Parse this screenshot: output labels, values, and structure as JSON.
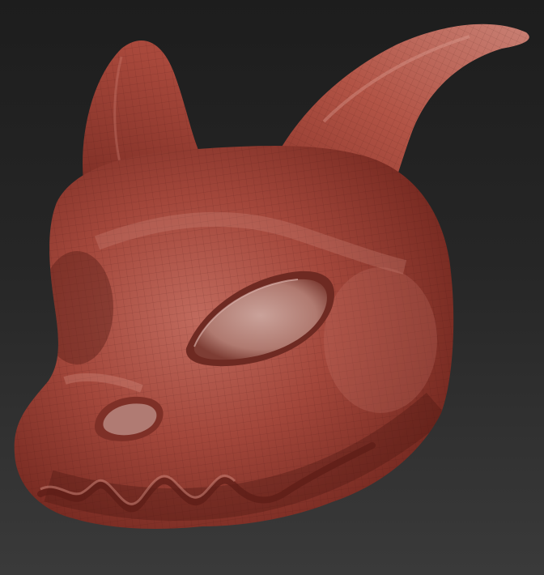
{
  "viewport": {
    "subject": "sculpted-creature-mask",
    "background_top": "#1d1d1d",
    "background_bottom": "#3a3a3a"
  },
  "model": {
    "material_base": "#a3473b",
    "material_light": "#c57265",
    "material_shadow": "#5c1f18",
    "material_highlight": "#e0b0a8",
    "eye_hole_color": "#b9857c",
    "wireframe_color": "#3c120d",
    "wireframe_visible": true
  }
}
